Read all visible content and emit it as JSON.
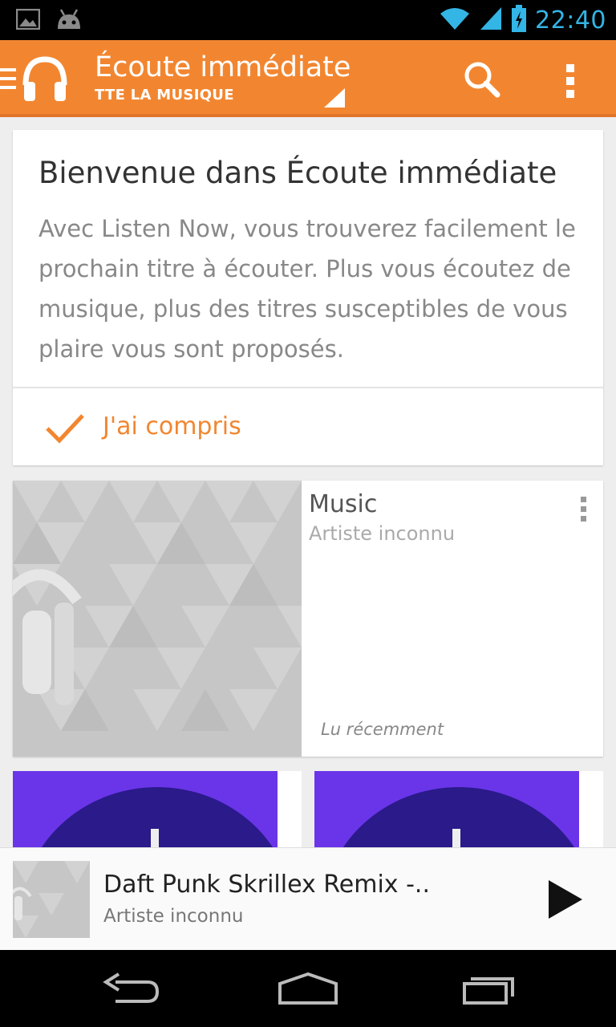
{
  "status_bar": {
    "time": "22:40",
    "icons": [
      "image-icon",
      "android-icon",
      "wifi-icon",
      "signal-icon",
      "battery-icon"
    ]
  },
  "action_bar": {
    "title": "Écoute immédiate",
    "subtitle": "TTE LA MUSIQUE",
    "accent_color": "#f28630"
  },
  "welcome_card": {
    "title": "Bienvenue dans Écoute immédiate",
    "body": "Avec Listen Now, vous trouverez facilement le prochain titre à écouter. Plus vous écoutez de musique, plus des titres susceptibles de vous plaire vous sont proposés.",
    "action_label": "J'ai compris"
  },
  "music_card": {
    "title": "Music",
    "artist": "Artiste inconnu",
    "tag": "Lu récemment"
  },
  "now_playing": {
    "title": "Daft Punk Skrillex Remix -..",
    "artist": "Artiste inconnu"
  }
}
